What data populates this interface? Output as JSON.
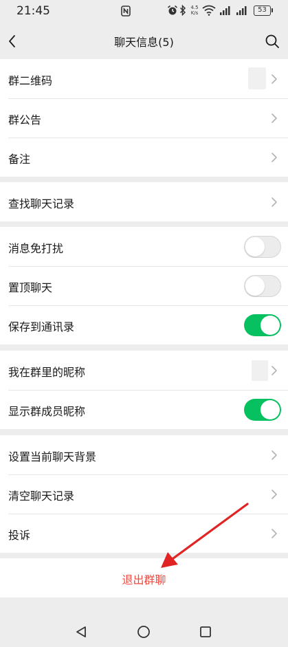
{
  "status_bar": {
    "time": "21:45",
    "network_speed_value": "4.5",
    "network_speed_unit": "K/s",
    "battery_level": "53",
    "icons": [
      "nfc-icon",
      "alarm-icon",
      "bluetooth-icon",
      "wifi-icon",
      "signal-icon",
      "signal-icon",
      "battery-icon"
    ]
  },
  "header": {
    "title": "聊天信息(5)",
    "icons": [
      "back-arrow-icon",
      "search-icon"
    ]
  },
  "settings": {
    "group1": {
      "qr_code": "群二维码",
      "announcement": "群公告",
      "remark": "备注"
    },
    "group2": {
      "search_history": "查找聊天记录"
    },
    "group3": {
      "mute": {
        "label": "消息免打扰",
        "enabled": false
      },
      "pin": {
        "label": "置顶聊天",
        "enabled": false
      },
      "save_contacts": {
        "label": "保存到通讯录",
        "enabled": true
      }
    },
    "group4": {
      "my_nickname": "我在群里的昵称",
      "show_nicknames": {
        "label": "显示群成员昵称",
        "enabled": true
      }
    },
    "group5": {
      "background": "设置当前聊天背景",
      "clear_history": "清空聊天记录",
      "report": "投诉"
    }
  },
  "exit_button": {
    "label": "退出群聊"
  },
  "colors": {
    "accent_green": "#07c160",
    "danger_red": "#f0473e",
    "annotation_red": "#e02424",
    "background": "#ededed"
  },
  "system_nav": {
    "icons": [
      "triangle-back-icon",
      "circle-home-icon",
      "square-recents-icon"
    ]
  }
}
